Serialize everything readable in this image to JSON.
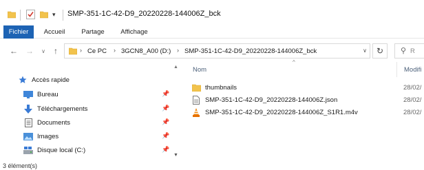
{
  "window": {
    "title": "SMP-351-1C-42-D9_20220228-144006Z_bck",
    "quick_access_dropdown": "▾"
  },
  "ribbon": {
    "tabs": [
      "Fichier",
      "Accueil",
      "Partage",
      "Affichage"
    ]
  },
  "address_bar": {
    "crumbs": [
      "Ce PC",
      "3GCN8_A00 (D:)",
      "SMP-351-1C-42-D9_20220228-144006Z_bck"
    ],
    "search_placeholder": "R"
  },
  "nav_pane": {
    "items": [
      {
        "label": "Accès rapide",
        "icon": "star-icon",
        "pinned": false
      },
      {
        "label": "Bureau",
        "icon": "desktop-icon",
        "pinned": true
      },
      {
        "label": "Téléchargements",
        "icon": "download-icon",
        "pinned": true
      },
      {
        "label": "Documents",
        "icon": "documents-icon",
        "pinned": true
      },
      {
        "label": "Images",
        "icon": "images-icon",
        "pinned": true
      },
      {
        "label": "Disque local (C:)",
        "icon": "drive-icon",
        "pinned": true
      }
    ]
  },
  "file_list": {
    "columns": [
      "Nom",
      "Modifi"
    ],
    "rows": [
      {
        "name": "thumbnails",
        "type": "folder",
        "date": "28/02/"
      },
      {
        "name": "SMP-351-1C-42-D9_20220228-144006Z.json",
        "type": "json",
        "date": "28/02/"
      },
      {
        "name": "SMP-351-1C-42-D9_20220228-144006Z_S1R1.m4v",
        "type": "video",
        "date": "28/02/"
      }
    ]
  },
  "status_bar": {
    "count": "3 élément(s)"
  },
  "colors": {
    "file_tab": "#1d63b4",
    "folder": "#f2c34d",
    "accent": "#3a7bd5"
  }
}
